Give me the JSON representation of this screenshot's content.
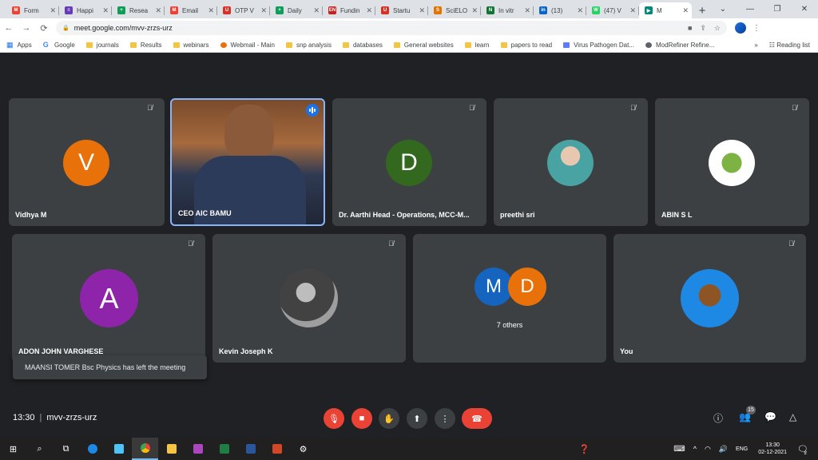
{
  "browser": {
    "tabs": [
      {
        "title": "Form",
        "fav": "M",
        "color": "#ea4335"
      },
      {
        "title": "Happi",
        "fav": "≡",
        "color": "#673ab7"
      },
      {
        "title": "Resea",
        "fav": "+",
        "color": "#0f9d58"
      },
      {
        "title": "Email",
        "fav": "M",
        "color": "#ea4335"
      },
      {
        "title": "OTP V",
        "fav": "U",
        "color": "#d93025"
      },
      {
        "title": "Daily",
        "fav": "+",
        "color": "#0f9d58"
      },
      {
        "title": "Fundin",
        "fav": "EN",
        "color": "#c5221f"
      },
      {
        "title": "Startu",
        "fav": "U",
        "color": "#d93025"
      },
      {
        "title": "SciELO",
        "fav": "S",
        "color": "#e37400"
      },
      {
        "title": "In vitr",
        "fav": "N",
        "color": "#137333"
      },
      {
        "title": "(13)",
        "fav": "in",
        "color": "#0a66c2"
      },
      {
        "title": "(47) V",
        "fav": "W",
        "color": "#25d366"
      },
      {
        "title": "M",
        "fav": "▶",
        "color": "#00897b"
      }
    ],
    "new_tab": "+",
    "url": "meet.google.com/mvv-zrzs-urz",
    "bookmarks": [
      "Apps",
      "Google",
      "journals",
      "Results",
      "webinars",
      "Webmail - Main",
      "snp analysis",
      "databases",
      "General websites",
      "learn",
      "papers to read",
      "Virus Pathogen Dat...",
      "ModRefiner Refine..."
    ],
    "bookmarks_overflow": "»",
    "reading_list": "Reading list"
  },
  "meet": {
    "tiles": [
      {
        "name": "Vidhya M",
        "letter": "V",
        "color": "#e8710a"
      },
      {
        "name": "CEO AIC BAMU"
      },
      {
        "name": "Dr. Aarthi Head - Operations, MCC-M...",
        "letter": "D",
        "color": "#33691e"
      },
      {
        "name": "preethi sri"
      },
      {
        "name": "ABIN S L"
      },
      {
        "name": "ADON JOHN VARGHESE",
        "letter": "A",
        "color": "#8e24aa"
      },
      {
        "name": "Kevin Joseph K"
      },
      {
        "name": "7 others",
        "letters": [
          "M",
          "D"
        ],
        "colors": [
          "#1565c0",
          "#e8710a"
        ]
      },
      {
        "name": "You"
      }
    ],
    "toast": "MAANSI TOMER Bsc Physics has left the meeting",
    "time": "13:30",
    "meeting_code": "mvv-zrzs-urz",
    "participants_count": "15"
  },
  "taskbar": {
    "lang": "ENG",
    "time": "13:30",
    "date": "02-12-2021",
    "notif_count": "2"
  }
}
